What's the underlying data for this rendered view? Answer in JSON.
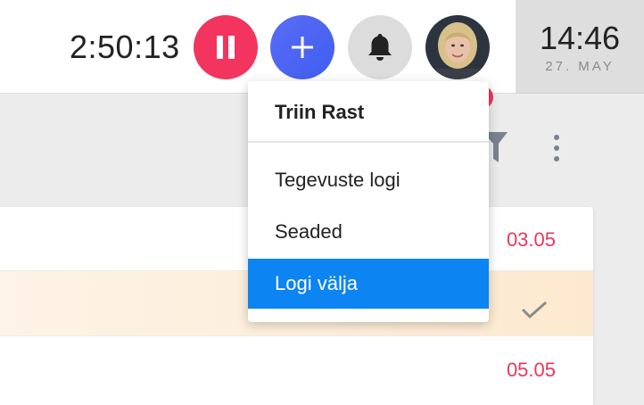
{
  "header": {
    "timer": "2:50:13",
    "pause_icon": "pause-icon",
    "add_icon": "plus-icon",
    "bell_icon": "bell-icon",
    "avatar_alt": "user-avatar"
  },
  "clock": {
    "time": "14:46",
    "date": "27. MAY"
  },
  "toolbar": {
    "filter_icon": "filter-icon",
    "more_icon": "more-vertical-icon"
  },
  "list": {
    "rows": [
      {
        "date": "03.05"
      },
      {
        "date": "",
        "done": true
      },
      {
        "date": "05.05"
      }
    ]
  },
  "user_menu": {
    "user_name": "Triin Rast",
    "items": [
      {
        "label": "Tegevuste logi"
      },
      {
        "label": "Seaded"
      },
      {
        "label": "Logi välja",
        "highlighted": true
      }
    ]
  },
  "colors": {
    "accent_red": "#f2345e",
    "accent_blue": "#0c84f2",
    "add_button": "#4a63f2",
    "date_text": "#e8365f"
  }
}
